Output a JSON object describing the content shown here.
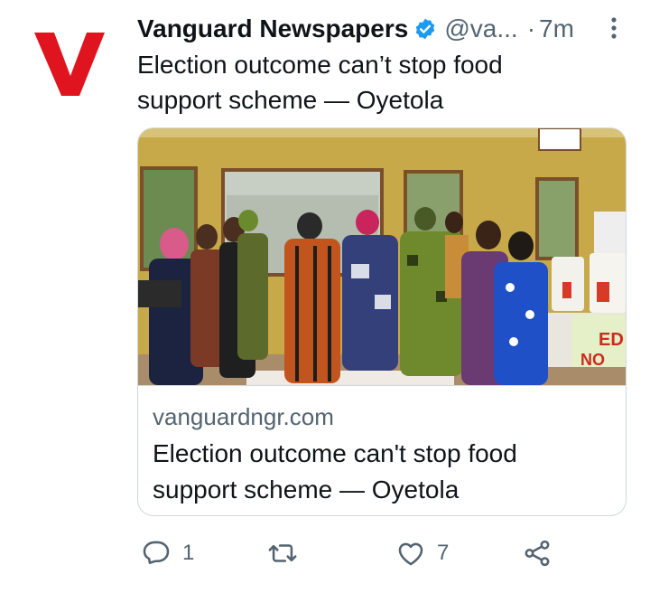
{
  "account": {
    "name": "Vanguard Newspapers",
    "handle": "@va...",
    "separator": "·",
    "time": "7m",
    "avatar_letter": "V",
    "brand_color": "#e0141e",
    "verified_color": "#1d9bf0"
  },
  "tweet": {
    "text_line1": "Election outcome can’t stop food",
    "text_line2": "support scheme — Oyetola"
  },
  "card": {
    "domain": "vanguardngr.com",
    "title_line1": "Election outcome can't stop food",
    "title_line2": "support scheme — Oyetola",
    "image_description_icon": "photo"
  },
  "actions": {
    "reply_count": "1",
    "retweet_count": "",
    "like_count": "7",
    "icons": [
      "reply-icon",
      "retweet-icon",
      "like-icon",
      "share-icon"
    ]
  }
}
